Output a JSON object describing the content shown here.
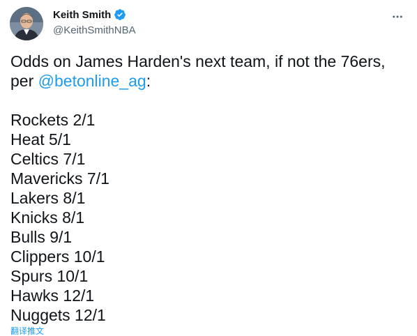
{
  "author": {
    "display_name": "Keith Smith",
    "handle": "@KeithSmithNBA",
    "verified": true,
    "verified_color": "#1d9bf0"
  },
  "tweet": {
    "line1": "Odds on James Harden's next team, if not the 76ers,",
    "line2_prefix": "per ",
    "mention": "@betonline_ag",
    "line2_suffix": ":",
    "odds": [
      "Rockets 2/1",
      "Heat 5/1",
      "Celtics 7/1",
      "Mavericks 7/1",
      "Lakers 8/1",
      "Knicks 8/1",
      "Bulls 9/1",
      "Clippers 10/1",
      "Spurs 10/1",
      "Hawks 12/1",
      "Nuggets 12/1"
    ]
  },
  "translate_label": "翻译推文",
  "icons": {
    "more": "more-horizontal-icon",
    "verified": "verified-badge-icon"
  },
  "colors": {
    "link": "#1d9bf0",
    "text": "#0f1419",
    "secondary": "#536471"
  }
}
